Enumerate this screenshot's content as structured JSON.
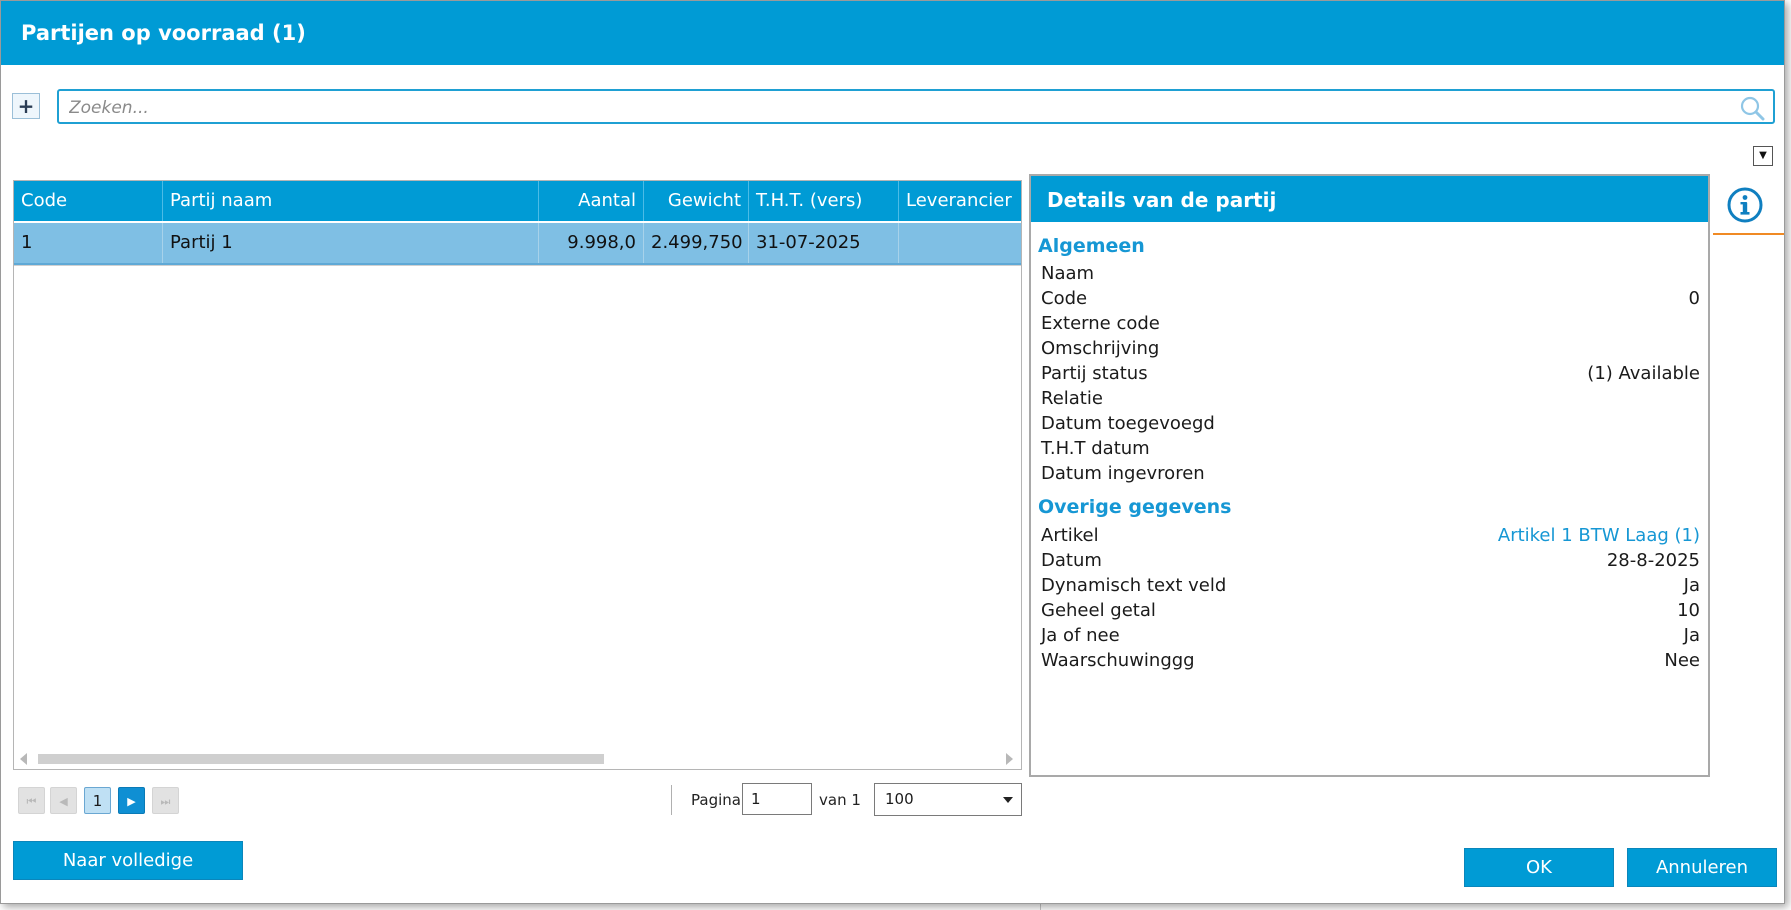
{
  "window": {
    "title": "Partijen op voorraad (1)"
  },
  "toolbar": {
    "add_label": "+",
    "search_placeholder": "Zoeken...",
    "search_value": ""
  },
  "grid": {
    "columns": [
      "Code",
      "Partij naam",
      "Aantal",
      "Gewicht",
      "T.H.T. (vers)",
      "Leverancier"
    ],
    "rows": [
      {
        "code": "1",
        "naam": "Partij 1",
        "aantal": "9.998,0",
        "gewicht": "2.499,750",
        "tht": "31-07-2025",
        "leverancier": ""
      }
    ],
    "selected_row": 0
  },
  "pager": {
    "current_page": "1",
    "page_label": "Pagina",
    "page_input": "1",
    "of_label": "van 1",
    "per_page": "100"
  },
  "details": {
    "title": "Details van de partij",
    "sections": [
      {
        "title": "Algemeen",
        "rows": [
          {
            "label": "Naam",
            "value": ""
          },
          {
            "label": "Code",
            "value": "0"
          },
          {
            "label": "Externe code",
            "value": ""
          },
          {
            "label": "Omschrijving",
            "value": ""
          },
          {
            "label": "Partij status",
            "value": "(1) Available"
          },
          {
            "label": "Relatie",
            "value": ""
          },
          {
            "label": "Datum toegevoegd",
            "value": ""
          },
          {
            "label": "T.H.T datum",
            "value": ""
          },
          {
            "label": "Datum ingevroren",
            "value": ""
          }
        ]
      },
      {
        "title": "Overige gegevens",
        "rows": [
          {
            "label": "Artikel",
            "value": "Artikel 1 BTW Laag (1)",
            "link": true
          },
          {
            "label": "Datum",
            "value": "28-8-2025"
          },
          {
            "label": "Dynamisch text veld",
            "value": "Ja"
          },
          {
            "label": "Geheel getal",
            "value": "10"
          },
          {
            "label": "Ja of nee",
            "value": "Ja"
          },
          {
            "label": "Waarschuwinggg",
            "value": "Nee"
          }
        ]
      }
    ]
  },
  "footer": {
    "full_selection_label": "Naar volledige partijselectie",
    "ok_label": "OK",
    "cancel_label": "Annuleren"
  },
  "colors": {
    "accent": "#009bd5",
    "selected_row": "#7fbfe4",
    "section_title": "#1697d4",
    "orange_marker": "#f08a24"
  },
  "icons": [
    "search-icon",
    "info-icon",
    "chevron-down-icon",
    "first-page-icon",
    "prev-page-icon",
    "next-page-icon",
    "last-page-icon"
  ]
}
